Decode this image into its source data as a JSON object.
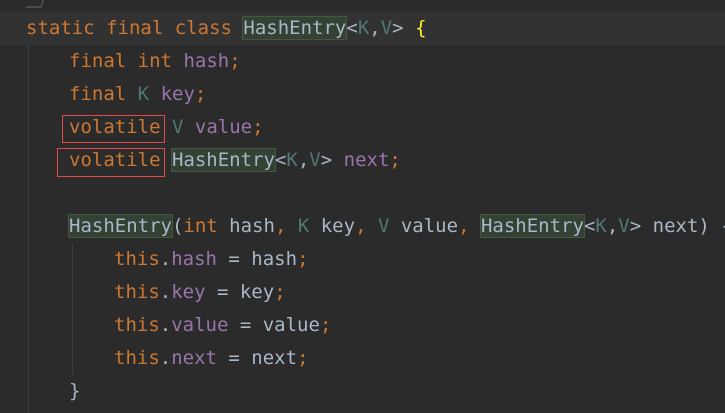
{
  "lines": [
    {
      "tokens": [
        {
          "t": "static",
          "c": "kw"
        },
        {
          "t": " ",
          "c": ""
        },
        {
          "t": "final",
          "c": "kw"
        },
        {
          "t": " ",
          "c": ""
        },
        {
          "t": "class",
          "c": "kw"
        },
        {
          "t": " ",
          "c": ""
        },
        {
          "t": "HashEntry",
          "c": "cls hl"
        },
        {
          "t": "<",
          "c": ""
        },
        {
          "t": "K",
          "c": "tp"
        },
        {
          "t": ",",
          "c": ""
        },
        {
          "t": "V",
          "c": "tp"
        },
        {
          "t": ">",
          "c": ""
        },
        {
          "t": " ",
          "c": ""
        },
        {
          "t": "{",
          "c": "brace-match"
        }
      ]
    },
    {
      "tokens": [
        {
          "t": "final",
          "c": "kw"
        },
        {
          "t": " ",
          "c": ""
        },
        {
          "t": "int",
          "c": "kw"
        },
        {
          "t": " ",
          "c": ""
        },
        {
          "t": "hash",
          "c": "fld"
        },
        {
          "t": ";",
          "c": "semi"
        }
      ]
    },
    {
      "tokens": [
        {
          "t": "final",
          "c": "kw"
        },
        {
          "t": " ",
          "c": ""
        },
        {
          "t": "K",
          "c": "tp"
        },
        {
          "t": " ",
          "c": ""
        },
        {
          "t": "key",
          "c": "fld"
        },
        {
          "t": ";",
          "c": "semi"
        }
      ]
    },
    {
      "tokens": [
        {
          "t": "volatile",
          "c": "kw"
        },
        {
          "t": " ",
          "c": ""
        },
        {
          "t": "V",
          "c": "tp"
        },
        {
          "t": " ",
          "c": ""
        },
        {
          "t": "value",
          "c": "fld"
        },
        {
          "t": ";",
          "c": "semi"
        }
      ]
    },
    {
      "tokens": [
        {
          "t": "volatile",
          "c": "kw"
        },
        {
          "t": " ",
          "c": ""
        },
        {
          "t": "HashEntry",
          "c": "cls hl"
        },
        {
          "t": "<",
          "c": ""
        },
        {
          "t": "K",
          "c": "tp"
        },
        {
          "t": ",",
          "c": ""
        },
        {
          "t": "V",
          "c": "tp"
        },
        {
          "t": ">",
          "c": ""
        },
        {
          "t": " ",
          "c": ""
        },
        {
          "t": "next",
          "c": "fld"
        },
        {
          "t": ";",
          "c": "semi"
        }
      ]
    },
    {
      "tokens": []
    },
    {
      "tokens": [
        {
          "t": "HashEntry",
          "c": "cls hl"
        },
        {
          "t": "(",
          "c": ""
        },
        {
          "t": "int",
          "c": "kw"
        },
        {
          "t": " hash",
          "c": ""
        },
        {
          "t": ",",
          "c": "semi"
        },
        {
          "t": " ",
          "c": ""
        },
        {
          "t": "K",
          "c": "tp"
        },
        {
          "t": " key",
          "c": ""
        },
        {
          "t": ",",
          "c": "semi"
        },
        {
          "t": " ",
          "c": ""
        },
        {
          "t": "V",
          "c": "tp"
        },
        {
          "t": " value",
          "c": ""
        },
        {
          "t": ",",
          "c": "semi"
        },
        {
          "t": " ",
          "c": ""
        },
        {
          "t": "HashEntry",
          "c": "cls hl"
        },
        {
          "t": "<",
          "c": ""
        },
        {
          "t": "K",
          "c": "tp"
        },
        {
          "t": ",",
          "c": ""
        },
        {
          "t": "V",
          "c": "tp"
        },
        {
          "t": ">",
          "c": ""
        },
        {
          "t": " next) {",
          "c": ""
        }
      ]
    },
    {
      "tokens": [
        {
          "t": "this",
          "c": "kw"
        },
        {
          "t": ".",
          "c": ""
        },
        {
          "t": "hash",
          "c": "fld"
        },
        {
          "t": " = hash",
          "c": ""
        },
        {
          "t": ";",
          "c": "semi"
        }
      ]
    },
    {
      "tokens": [
        {
          "t": "this",
          "c": "kw"
        },
        {
          "t": ".",
          "c": ""
        },
        {
          "t": "key",
          "c": "fld"
        },
        {
          "t": " = key",
          "c": ""
        },
        {
          "t": ";",
          "c": "semi"
        }
      ]
    },
    {
      "tokens": [
        {
          "t": "this",
          "c": "kw"
        },
        {
          "t": ".",
          "c": ""
        },
        {
          "t": "value",
          "c": "fld"
        },
        {
          "t": " = value",
          "c": ""
        },
        {
          "t": ";",
          "c": "semi"
        }
      ]
    },
    {
      "tokens": [
        {
          "t": "this",
          "c": "kw"
        },
        {
          "t": ".",
          "c": ""
        },
        {
          "t": "next",
          "c": "fld"
        },
        {
          "t": " = next",
          "c": ""
        },
        {
          "t": ";",
          "c": "semi"
        }
      ]
    },
    {
      "tokens": [
        {
          "t": "}",
          "c": ""
        }
      ]
    }
  ],
  "colors": {
    "background": "#2b2b2b",
    "keyword": "#cc7832",
    "type_param": "#507874",
    "field": "#9876aa",
    "plain": "#a9b7c6",
    "highlight": "#344134",
    "annotation_box": "#e24a4a",
    "brace_match": "#ffef28"
  }
}
